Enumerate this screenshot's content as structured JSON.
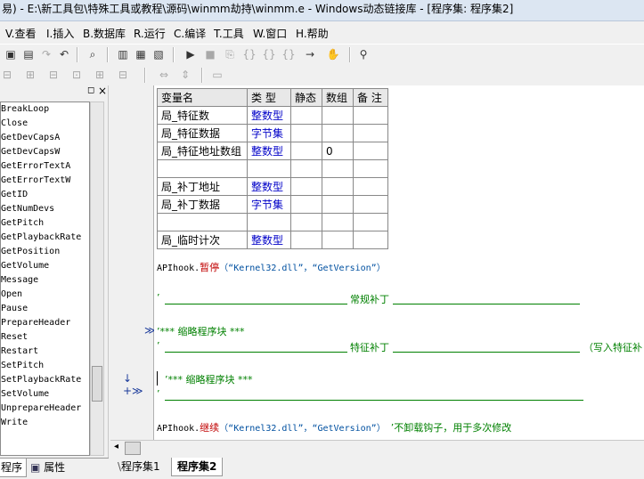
{
  "window": {
    "title": "易) - E:\\新工具包\\特殊工具或教程\\源码\\winmm劫持\\winmm.e - Windows动态链接库 - [程序集: 程序集2]"
  },
  "menu": {
    "items": [
      "V.查看",
      "I.插入",
      "B.数据库",
      "R.运行",
      "C.编译",
      "T.工具",
      "W.窗口",
      "H.帮助"
    ]
  },
  "toolbar": {
    "icons": [
      "paste-icon",
      "clipboard-icon",
      "redo-icon",
      "undo-icon",
      "find-icon",
      "layout1-icon",
      "layout2-icon",
      "layout3-icon",
      "run-icon",
      "stop-icon",
      "step-icon",
      "step-into-icon",
      "step-over-icon",
      "step-out-icon",
      "run-to-icon",
      "hand-icon",
      "binoculars-icon"
    ]
  },
  "left_panel": {
    "items": [
      "BreakLoop",
      "Close",
      "GetDevCapsA",
      "GetDevCapsW",
      "GetErrorTextA",
      "GetErrorTextW",
      "GetID",
      "GetNumDevs",
      "GetPitch",
      "GetPlaybackRate",
      "GetPosition",
      "GetVolume",
      "Message",
      "Open",
      "Pause",
      "PrepareHeader",
      "Reset",
      "Restart",
      "SetPitch",
      "SetPlaybackRate",
      "SetVolume",
      "UnprepareHeader",
      "Write"
    ],
    "tabs": [
      "程序",
      "属性"
    ]
  },
  "var_table": {
    "headers": [
      "变量名",
      "类 型",
      "静态",
      "数组",
      "备 注"
    ],
    "rows": [
      [
        "局_特征数",
        "整数型",
        "",
        "",
        ""
      ],
      [
        "局_特征数据",
        "字节集",
        "",
        "",
        ""
      ],
      [
        "局_特征地址数组",
        "整数型",
        "",
        "0",
        ""
      ],
      [
        "",
        "",
        "",
        "",
        ""
      ],
      [
        "局_补丁地址",
        "整数型",
        "",
        "",
        ""
      ],
      [
        "局_补丁数据",
        "字节集",
        "",
        "",
        ""
      ],
      [
        "",
        "",
        "",
        "",
        ""
      ],
      [
        "局_临时计次",
        "整数型",
        "",
        "",
        ""
      ]
    ]
  },
  "code": {
    "l1_obj": "APIhook.",
    "l1_cmd": "暂停",
    "l1_args": "（“Kernel32.dll”，“GetVersion”）",
    "l2_quote": "’",
    "l2_text": "常规补丁",
    "l3_text": "’*** 缩略程序块 ***",
    "l4_quote": "’",
    "l4_text": "特征补丁",
    "l4_tail": "（写入特征补",
    "l5_text": "’*** 缩略程序块 ***",
    "l6_quote": "’",
    "l7_obj": "APIhook.",
    "l7_cmd": "继续",
    "l7_args": "（“Kernel32.dll”，“GetVersion”）",
    "l7_comment": "’不卸载钩子，用于多次修改"
  },
  "gutter": {
    "fold1": "≫",
    "fold2": "↓ +≫"
  },
  "bottom_tabs": [
    "程序集1",
    "程序集2"
  ],
  "colors": {
    "comment": "#008000",
    "command": "#c00000",
    "type": "#0000c8"
  }
}
